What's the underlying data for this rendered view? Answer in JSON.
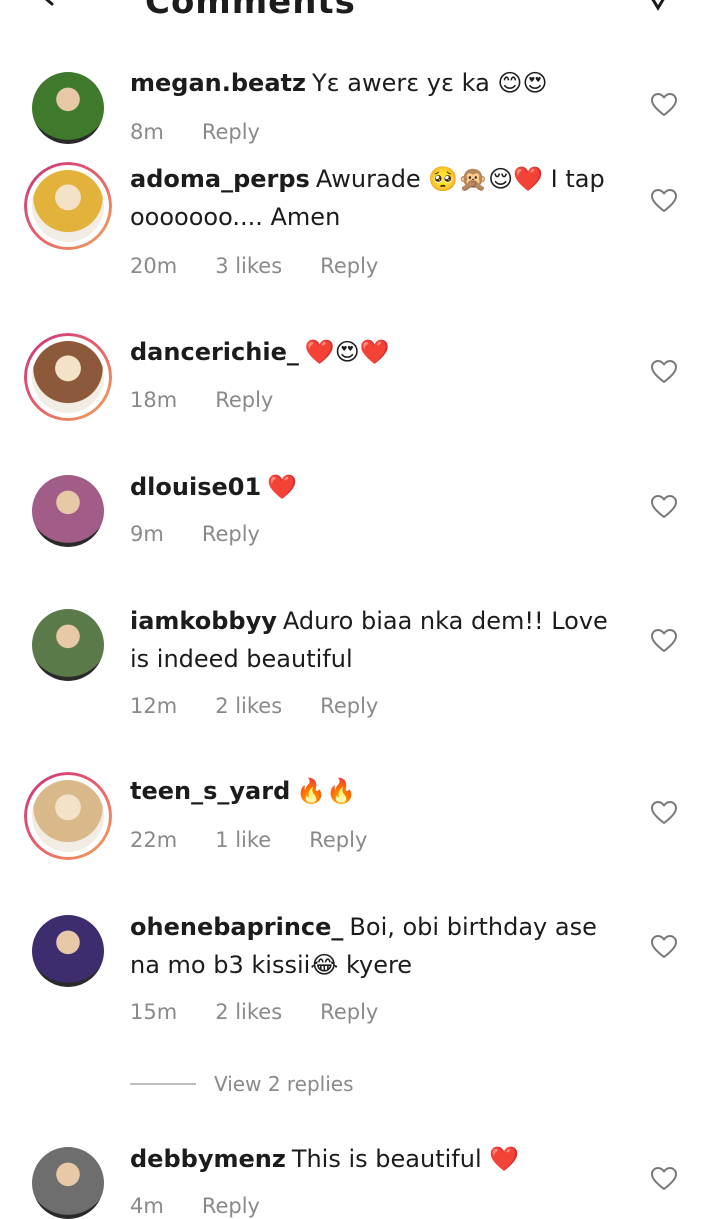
{
  "header": {
    "title": "Comments"
  },
  "comments": [
    {
      "username": "megan.beatz",
      "text": "Yɛ awerɛ yɛ ka 😊😍",
      "time": "8m",
      "likes": "",
      "reply": "Reply",
      "story": false,
      "avatar_color": "#3f7a2c"
    },
    {
      "username": "adoma_perps",
      "text": "Awurade 🥺🙊😌❤️ I tap ooooooo.... Amen",
      "time": "20m",
      "likes": "3 likes",
      "reply": "Reply",
      "story": true,
      "avatar_color": "#e3b23a"
    },
    {
      "username": "dancerichie_",
      "text": "❤️😍❤️",
      "time": "18m",
      "likes": "",
      "reply": "Reply",
      "story": true,
      "avatar_color": "#8c5a3a"
    },
    {
      "username": "dlouise01",
      "text": "❤️",
      "time": "9m",
      "likes": "",
      "reply": "Reply",
      "story": false,
      "avatar_color": "#a15c88"
    },
    {
      "username": "iamkobbyy",
      "text": "Aduro biaa nka dem!! Love is indeed beautiful",
      "time": "12m",
      "likes": "2 likes",
      "reply": "Reply",
      "story": false,
      "avatar_color": "#5b7a4a"
    },
    {
      "username": "teen_s_yard",
      "text": "🔥🔥",
      "time": "22m",
      "likes": "1 like",
      "reply": "Reply",
      "story": true,
      "avatar_color": "#d9b98a"
    },
    {
      "username": "ohenebaprince_",
      "text": "Boi, obi birthday ase na mo b3 kissii😂 kyere",
      "time": "15m",
      "likes": "2 likes",
      "reply": "Reply",
      "story": false,
      "avatar_color": "#3d2c6e"
    },
    {
      "username": "debbymenz",
      "text": "This is beautiful ❤️",
      "time": "4m",
      "likes": "",
      "reply": "Reply",
      "story": false,
      "avatar_color": "#6e6e6e"
    }
  ],
  "view_replies": "View 2 replies"
}
